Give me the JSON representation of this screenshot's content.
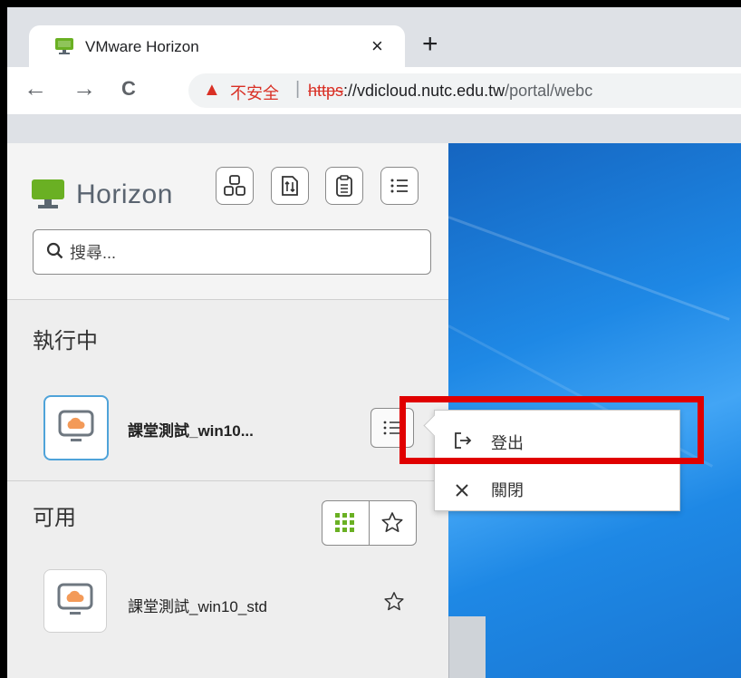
{
  "browser": {
    "tab": {
      "title": "VMware Horizon",
      "close": "×"
    },
    "new_tab": "+",
    "nav": {
      "back": "←",
      "forward": "→",
      "reload": "C"
    },
    "address": {
      "security_label": "不安全",
      "separator": "|",
      "url_scheme": "https",
      "url_rest_host": "://vdicloud.nutc.edu.tw",
      "url_path": "/portal/webc"
    }
  },
  "sidebar": {
    "brand": "Horizon",
    "search_placeholder": "搜尋...",
    "running": {
      "title": "執行中",
      "apps": [
        {
          "name": "課堂測試_win10..."
        }
      ]
    },
    "available": {
      "title": "可用",
      "apps": [
        {
          "name": "課堂測試_win10_std"
        }
      ]
    }
  },
  "context_menu": {
    "items": [
      {
        "label": "登出",
        "icon": "logout-icon"
      },
      {
        "label": "關閉",
        "icon": "close-icon"
      }
    ]
  },
  "colors": {
    "brand_green": "#6ab023",
    "highlight": "#e00000",
    "warning_red": "#d93025"
  }
}
